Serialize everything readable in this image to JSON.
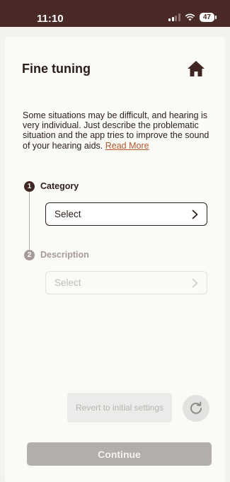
{
  "status_bar": {
    "time": "11:10",
    "battery": "47"
  },
  "header": {
    "title": "Fine tuning"
  },
  "intro": {
    "text": "Some situations may be difficult, and hearing is very individual. Just describe the problematic situation and the app tries to improve the sound of your hearing aids.",
    "read_more": "Read More"
  },
  "steps": [
    {
      "number": "1",
      "label": "Category",
      "select_value": "Select"
    },
    {
      "number": "2",
      "label": "Description",
      "select_value": "Select"
    }
  ],
  "revert": {
    "label": "Revert to initial settings"
  },
  "continue_label": "Continue",
  "colors": {
    "brand_dark": "#4a2a26",
    "link": "#b5562a",
    "disabled": "#b3aeaa"
  }
}
